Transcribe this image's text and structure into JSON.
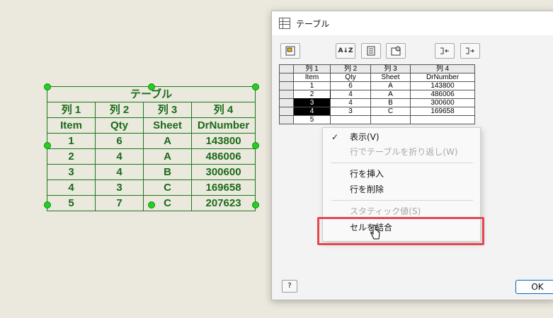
{
  "drawing_table": {
    "title": "テーブル",
    "headers": [
      "列 1",
      "列 2",
      "列 3",
      "列 4"
    ],
    "rows": [
      [
        "Item",
        "Qty",
        "Sheet",
        "DrNumber"
      ],
      [
        "1",
        "6",
        "A",
        "143800"
      ],
      [
        "2",
        "4",
        "A",
        "486006"
      ],
      [
        "3",
        "4",
        "B",
        "300600"
      ],
      [
        "4",
        "3",
        "C",
        "169658"
      ],
      [
        "5",
        "7",
        "C",
        "207623"
      ]
    ]
  },
  "dialog": {
    "title": "テーブル",
    "toolbar": {
      "sort_label": "A↓Z"
    },
    "grid": {
      "headers": [
        "列 1",
        "列 2",
        "列 3",
        "列 4"
      ],
      "rows": [
        [
          "Item",
          "Qty",
          "Sheet",
          "DrNumber"
        ],
        [
          "1",
          "6",
          "A",
          "143800"
        ],
        [
          "2",
          "4",
          "A",
          "486006"
        ],
        [
          "3",
          "4",
          "B",
          "300600"
        ],
        [
          "4",
          "3",
          "C",
          "169658"
        ],
        [
          "5",
          "",
          "",
          ""
        ]
      ]
    },
    "help_label": "?",
    "ok_label": "OK"
  },
  "context_menu": {
    "items": [
      {
        "label": "表示(V)",
        "checked": true,
        "enabled": true
      },
      {
        "label": "行でテーブルを折り返し(W)",
        "enabled": false
      },
      {
        "label": "行を挿入",
        "enabled": true
      },
      {
        "label": "行を削除",
        "enabled": true
      },
      {
        "label": "スタティック値(S)",
        "enabled": false
      },
      {
        "label": "セルを結合",
        "enabled": true,
        "highlighted": true
      }
    ],
    "checkmark": "✓"
  },
  "colors": {
    "table_green": "#1a6b1a",
    "grip_green": "#22d022",
    "highlight_red": "#e2484f",
    "ok_border": "#0067c0"
  }
}
